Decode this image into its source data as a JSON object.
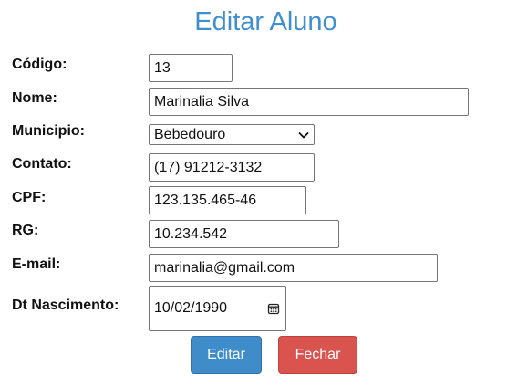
{
  "page": {
    "title": "Editar Aluno"
  },
  "form": {
    "codigo": {
      "label": "Código:",
      "value": "13"
    },
    "nome": {
      "label": "Nome:",
      "value": "Marinalia Silva"
    },
    "municipio": {
      "label": "Municipio:",
      "value": "Bebedouro"
    },
    "contato": {
      "label": "Contato:",
      "value": "(17) 91212-3132"
    },
    "cpf": {
      "label": "CPF:",
      "value": "123.135.465-46"
    },
    "rg": {
      "label": "RG:",
      "value": "10.234.542"
    },
    "email": {
      "label": "E-mail:",
      "value": "marinalia@gmail.com"
    },
    "nascimento": {
      "label": "Dt Nascimento:",
      "value": "10/02/1990",
      "icon": "calendar-icon"
    }
  },
  "buttons": {
    "edit_label": "Editar",
    "close_label": "Fechar",
    "edit_color": "#3f8ccb",
    "close_color": "#d9534f"
  },
  "colors": {
    "title": "#3f8fd0"
  }
}
